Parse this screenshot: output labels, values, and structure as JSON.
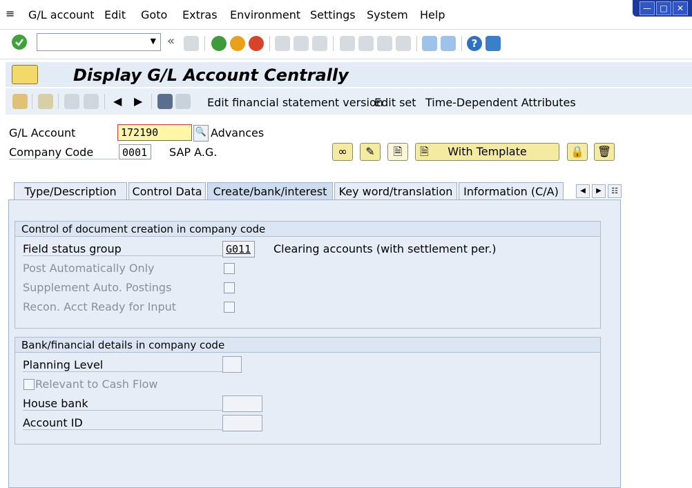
{
  "menu": {
    "items": [
      "G/L account",
      "Edit",
      "Goto",
      "Extras",
      "Environment",
      "Settings",
      "System",
      "Help"
    ]
  },
  "window_controls": [
    "minimize",
    "maximize",
    "close"
  ],
  "title": "Display G/L Account Centrally",
  "app_toolbar": {
    "links": [
      "Edit financial statement version",
      "Edit set",
      "Time-Dependent Attributes"
    ]
  },
  "header": {
    "gl_account_label": "G/L Account",
    "gl_account_value": "172190",
    "gl_account_desc": "Advances",
    "company_code_label": "Company Code",
    "company_code_value": "0001",
    "company_code_desc": "SAP A.G.",
    "with_template_label": "With Template"
  },
  "tabs": [
    "Type/Description",
    "Control Data",
    "Create/bank/interest",
    "Key word/translation",
    "Information (C/A)"
  ],
  "active_tab": "Create/bank/interest",
  "group1": {
    "title": "Control of document creation in company code",
    "field_status_group_label": "Field status group",
    "field_status_group_value": "G011",
    "field_status_group_desc": "Clearing accounts (with settlement per.)",
    "post_auto_label": "Post Automatically Only",
    "supplement_label": "Supplement Auto. Postings",
    "recon_label": "Recon. Acct Ready for Input"
  },
  "group2": {
    "title": "Bank/financial details in company code",
    "planning_level_label": "Planning Level",
    "cash_flow_label": "Relevant to Cash Flow",
    "house_bank_label": "House bank",
    "account_id_label": "Account ID"
  },
  "colors": {
    "accent": "#1d3a9a",
    "highlight_field": "#fff6a8",
    "button_yellow": "#f4eaa0",
    "panel": "#e6edf6"
  }
}
